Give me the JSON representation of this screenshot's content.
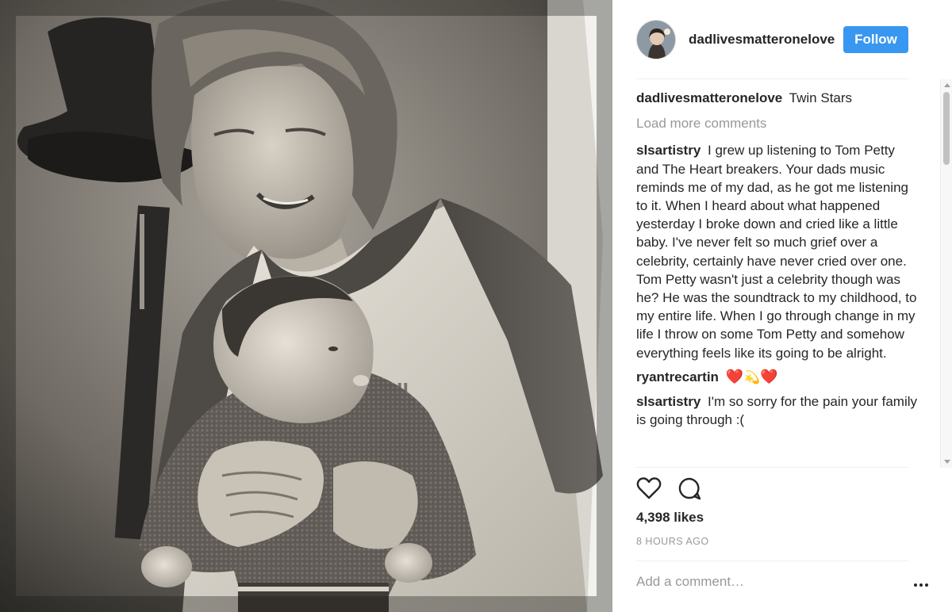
{
  "post": {
    "photo_alt_icon": "photo-icon"
  },
  "header": {
    "username": "dadlivesmatteronelove",
    "follow_label": "Follow",
    "follow_color": "#3897f0"
  },
  "caption": {
    "user": "dadlivesmatteronelove",
    "text": "Twin Stars"
  },
  "load_more_label": "Load more comments",
  "comments": [
    {
      "user": "slsartistry",
      "text": "I grew up listening to Tom Petty and The Heart breakers. Your dads music reminds me of my dad, as he got me listening to it. When I heard about what happened yesterday I broke down and cried like a little baby. I've never felt so much grief over a celebrity, certainly have never cried over one. Tom Petty wasn't just a celebrity though was he? He was the soundtrack to my childhood, to my entire life. When I go through change in my life I throw on some Tom Petty and somehow everything feels like its going to be alright."
    },
    {
      "user": "ryantrecartin",
      "emoji": [
        "❤️",
        "💫",
        "❤️"
      ]
    },
    {
      "user": "slsartistry",
      "text": "I'm so sorry for the pain your family is going through :("
    }
  ],
  "actions": {
    "like_icon": "heart-outline-icon",
    "comment_icon": "comment-bubble-icon"
  },
  "likes_text": "4,398 likes",
  "timestamp": "8 HOURS AGO",
  "add_comment_placeholder": "Add a comment…",
  "colors": {
    "accent": "#3897f0",
    "muted_text": "#999999",
    "text": "#262626",
    "divider": "#efefef"
  }
}
